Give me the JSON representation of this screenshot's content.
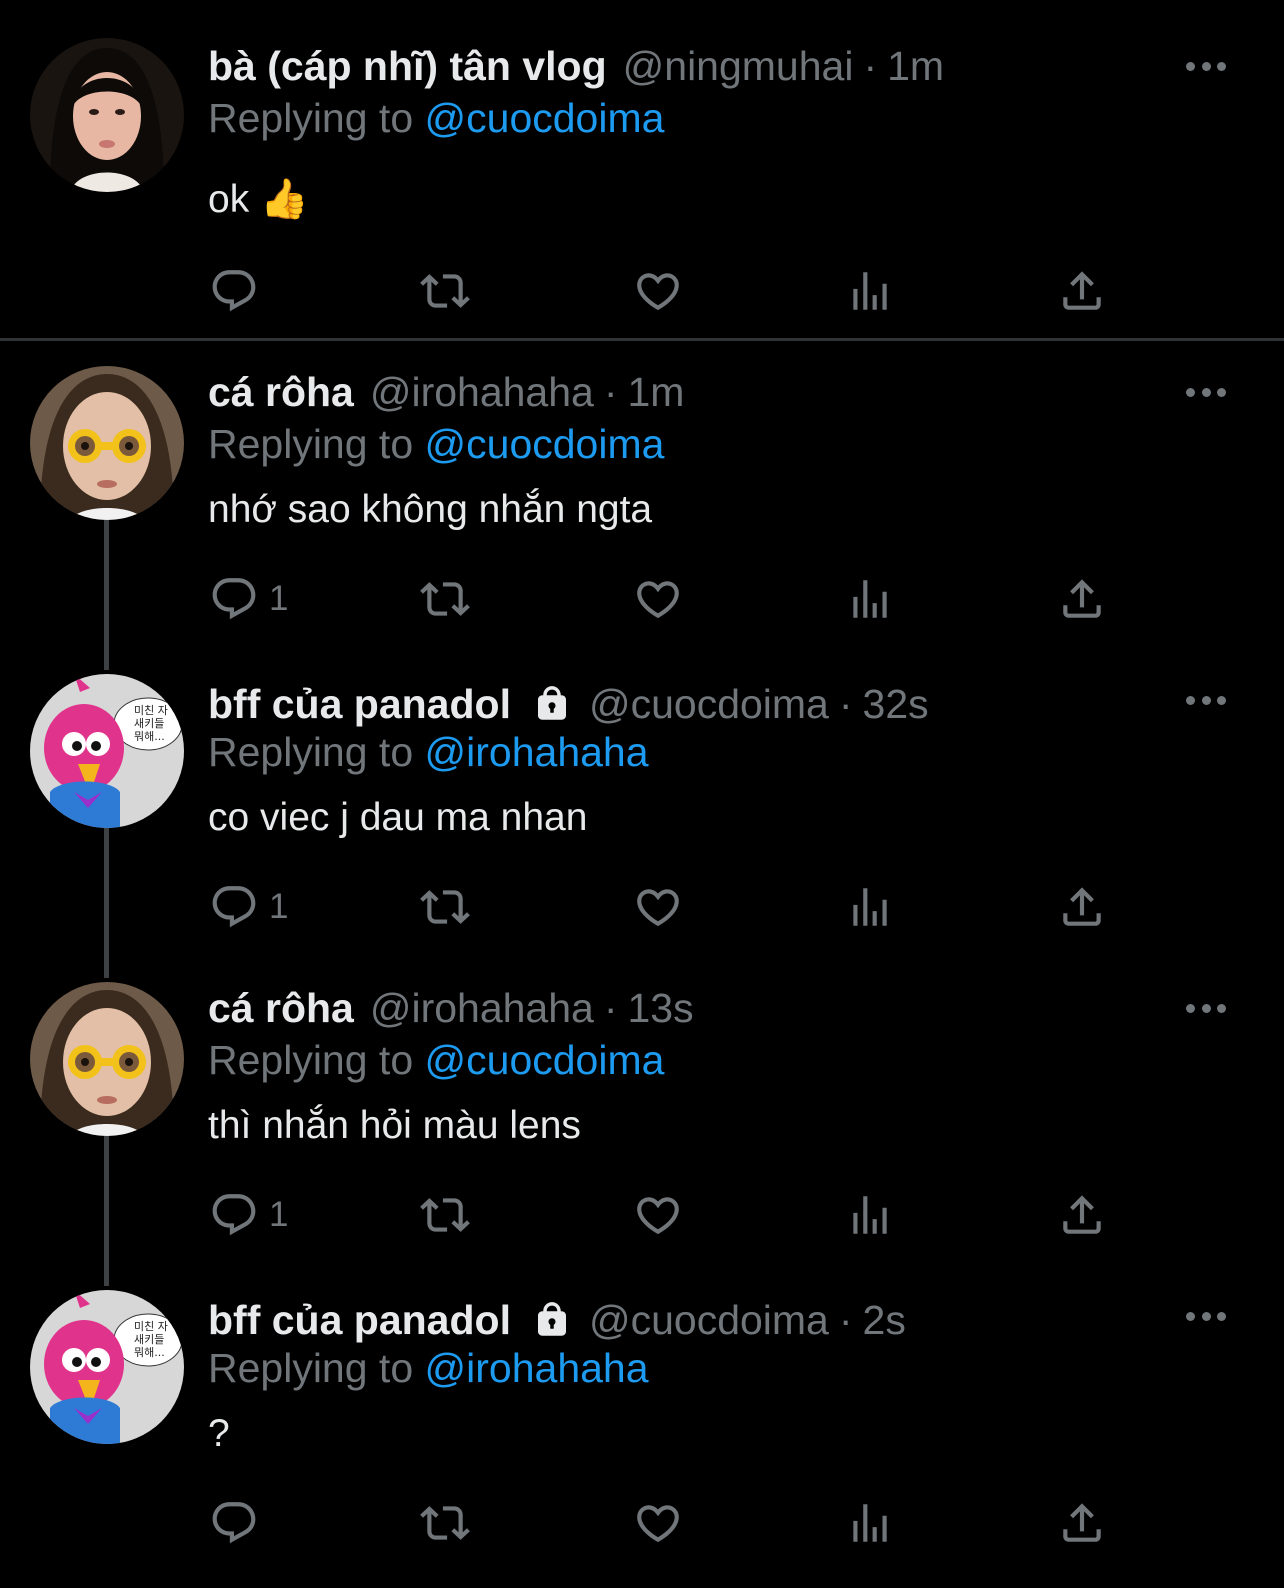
{
  "tweets": [
    {
      "name": "bà (cáp nhĩ) tân vlog",
      "handle": "@ningmuhai",
      "dot": "·",
      "time": "1m",
      "reply_prefix": "Replying to",
      "reply_to": "@cuocdoima",
      "text": "ok 👍",
      "reply_count": "",
      "locked": false
    },
    {
      "name": "cá rôha",
      "handle": "@irohahaha",
      "dot": "·",
      "time": "1m",
      "reply_prefix": "Replying to",
      "reply_to": "@cuocdoima",
      "text": "nhớ sao không nhắn ngta",
      "reply_count": "1",
      "locked": false
    },
    {
      "name": "bff của panadol",
      "handle": "@cuocdoima",
      "dot": "·",
      "time": "32s",
      "reply_prefix": "Replying to",
      "reply_to": "@irohahaha",
      "text": "co viec j dau ma nhan",
      "reply_count": "1",
      "locked": true
    },
    {
      "name": "cá rôha",
      "handle": "@irohahaha",
      "dot": "·",
      "time": "13s",
      "reply_prefix": "Replying to",
      "reply_to": "@cuocdoima",
      "text": "thì nhắn hỏi màu lens",
      "reply_count": "1",
      "locked": false
    },
    {
      "name": "bff của panadol",
      "handle": "@cuocdoima",
      "dot": "·",
      "time": "2s",
      "reply_prefix": "Replying to",
      "reply_to": "@irohahaha",
      "text": "?",
      "reply_count": "",
      "locked": true
    }
  ],
  "avatar_bubble_text": [
    "미친 자",
    "새키들",
    "뭐해..."
  ],
  "icons": [
    "reply-icon",
    "retweet-icon",
    "like-icon",
    "views-icon",
    "share-icon",
    "more-icon",
    "lock-icon"
  ],
  "colors": {
    "background": "#000000",
    "text": "#e7e9ea",
    "muted": "#71767b",
    "mention": "#1d9bf0",
    "divider": "#2f3336"
  }
}
